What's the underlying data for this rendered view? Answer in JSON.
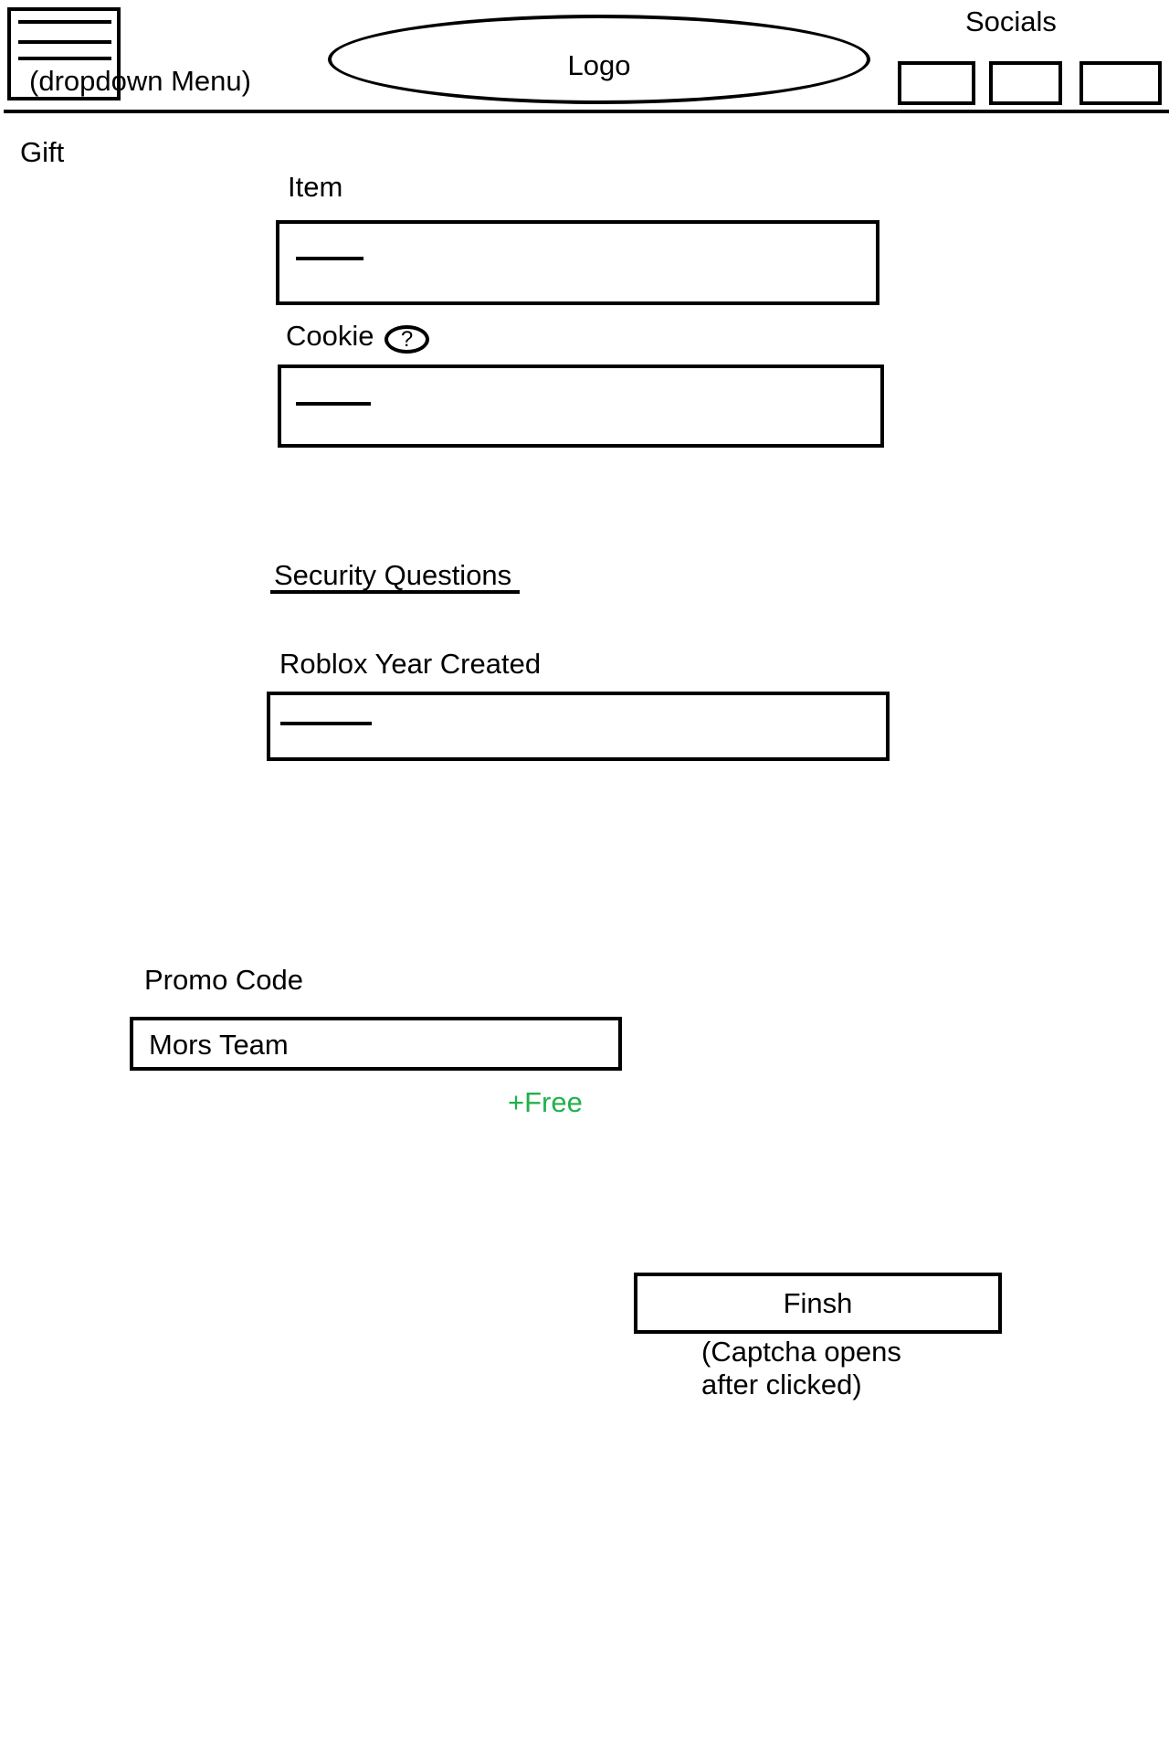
{
  "header": {
    "menu_label": "(dropdown Menu)",
    "logo_text": "Logo",
    "socials_label": "Socials",
    "social_icons": [
      "social-icon-1",
      "social-icon-2",
      "social-icon-3"
    ]
  },
  "form": {
    "section_label": "Gift",
    "item_label": "Item",
    "item_value": "",
    "cookie_label": "Cookie",
    "cookie_help_icon": "?",
    "cookie_value": "",
    "security_heading": "Security Questions",
    "year_label": "Roblox Year Created",
    "year_value": ""
  },
  "promo": {
    "label": "Promo Code",
    "value": "Mors Team",
    "bonus": "+Free",
    "bonus_color": "#22b14c"
  },
  "finish": {
    "label": "Finsh",
    "note_line1": "(Captcha opens",
    "note_line2": "after clicked)"
  }
}
